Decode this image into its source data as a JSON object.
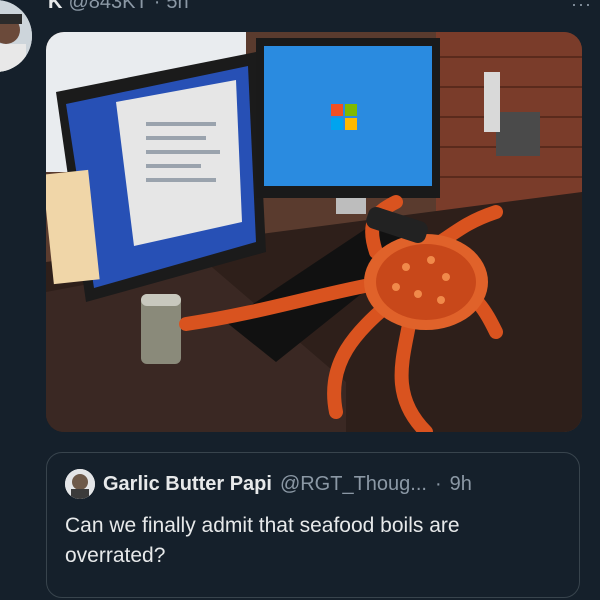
{
  "tweet": {
    "name_initial": "K",
    "handle": "@843KT",
    "separator": "·",
    "time": "5h",
    "more_label": "···"
  },
  "media": {
    "description_icon": "photo"
  },
  "quote": {
    "name": "Garlic Butter Papi",
    "handle": "@RGT_Thoug...",
    "separator": "·",
    "time": "9h",
    "text": "Can we finally admit that seafood boils are overrated?"
  },
  "colors": {
    "background": "#15202b",
    "text_primary": "#e7e9ea",
    "text_secondary": "#8b98a5",
    "border": "#38444d"
  }
}
